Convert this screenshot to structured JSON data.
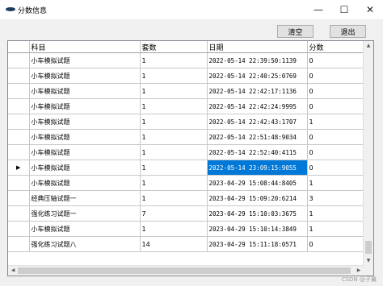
{
  "window": {
    "title": "分数信息",
    "minimize_glyph": "—",
    "maximize_glyph": "☐",
    "close_glyph": "✕"
  },
  "toolbar": {
    "clear_label": "清空",
    "exit_label": "退出"
  },
  "grid": {
    "columns": [
      "科目",
      "套数",
      "日期",
      "分数"
    ],
    "current_row_marker": "▶",
    "selected_row_index": 7,
    "rows": [
      {
        "subject": "小车模拟试题",
        "sets": "1",
        "date": "2022-05-14 22:39:50:1139",
        "score": "0"
      },
      {
        "subject": "小车模拟试题",
        "sets": "1",
        "date": "2022-05-14 22:40:25:0769",
        "score": "0"
      },
      {
        "subject": "小车模拟试题",
        "sets": "1",
        "date": "2022-05-14 22:42:17:1136",
        "score": "0"
      },
      {
        "subject": "小车模拟试题",
        "sets": "1",
        "date": "2022-05-14 22:42:24:9995",
        "score": "0"
      },
      {
        "subject": "小车模拟试题",
        "sets": "1",
        "date": "2022-05-14 22:42:43:1707",
        "score": "1"
      },
      {
        "subject": "小车模拟试题",
        "sets": "1",
        "date": "2022-05-14 22:51:48:9034",
        "score": "0"
      },
      {
        "subject": "小车模拟试题",
        "sets": "1",
        "date": "2022-05-14 22:52:40:4115",
        "score": "0"
      },
      {
        "subject": "小车模拟试题",
        "sets": "1",
        "date": "2022-05-14 23:09:15:9055",
        "score": "0"
      },
      {
        "subject": "小车模拟试题",
        "sets": "1",
        "date": "2023-04-29 15:08:44:8405",
        "score": "1"
      },
      {
        "subject": "经典压轴试题一",
        "sets": "1",
        "date": "2023-04-29 15:09:20:6214",
        "score": "3"
      },
      {
        "subject": "强化练习试题一",
        "sets": "7",
        "date": "2023-04-29 15:10:03:3675",
        "score": "1"
      },
      {
        "subject": "小车模拟试题",
        "sets": "1",
        "date": "2023-04-29 15:10:14:3849",
        "score": "1"
      },
      {
        "subject": "强化练习试题八",
        "sets": "14",
        "date": "2023-04-29 15:11:18:0571",
        "score": "0"
      }
    ]
  },
  "scroll_arrows": {
    "up": "▲",
    "down": "▼",
    "left": "◀",
    "right": "▶"
  },
  "watermark": "CSDN @子翼"
}
